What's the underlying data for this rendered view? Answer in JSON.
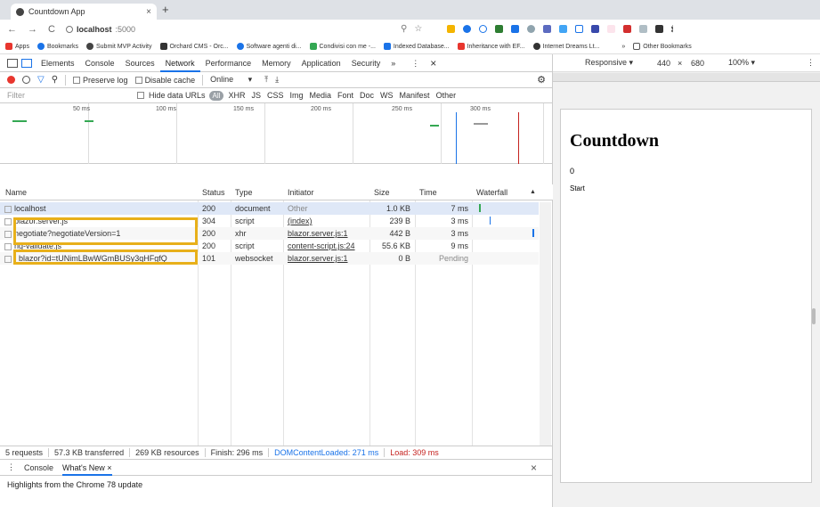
{
  "browser": {
    "tab_title": "Countdown App",
    "tab_close": "×",
    "new_tab": "+",
    "nav_back": "←",
    "nav_forward": "→",
    "nav_reload": "C",
    "url_host": "localhost",
    "url_port": ":5000"
  },
  "bookmarks": [
    {
      "label": "Apps",
      "color": "#e8362e"
    },
    {
      "label": "Bookmarks",
      "color": "#1a73e8"
    },
    {
      "label": "Submit MVP Activity",
      "color": "#444444"
    },
    {
      "label": "Orchard CMS - Orc...",
      "color": "#333333"
    },
    {
      "label": "Software agenti di...",
      "color": "#1a73e8"
    },
    {
      "label": "Condivisi con me -...",
      "color": "#34a853"
    },
    {
      "label": "Indexed Database...",
      "color": "#1a73e8"
    },
    {
      "label": "Inheritance with EF...",
      "color": "#e8362e"
    },
    {
      "label": "Internet Dreams Lt...",
      "color": "#333333"
    }
  ],
  "bookmarks_more": "»",
  "bookmarks_other": "Other Bookmarks",
  "devtools": {
    "tabs": [
      "Elements",
      "Console",
      "Sources",
      "Network",
      "Performance",
      "Memory",
      "Application",
      "Security",
      "»"
    ],
    "active_tab": "Network",
    "close": "×",
    "toolbar": {
      "preserve_log": "Preserve log",
      "disable_cache": "Disable cache",
      "online": "Online",
      "online_arrow": "▾"
    },
    "filter": {
      "placeholder": "Filter",
      "hide_data_urls": "Hide data URLs",
      "all": "All",
      "types": [
        "XHR",
        "JS",
        "CSS",
        "Img",
        "Media",
        "Font",
        "Doc",
        "WS",
        "Manifest",
        "Other"
      ]
    },
    "timeline_ticks": [
      "50 ms",
      "100 ms",
      "150 ms",
      "200 ms",
      "250 ms",
      "300 ms"
    ],
    "columns": [
      "Name",
      "Status",
      "Type",
      "Initiator",
      "Size",
      "Time",
      "Waterfall"
    ],
    "sort_indicator": "▲",
    "requests": [
      {
        "name": "localhost",
        "status": "200",
        "type": "document",
        "initiator": "Other",
        "size": "1.0 KB",
        "time": "7 ms"
      },
      {
        "name": "blazor.server.js",
        "status": "304",
        "type": "script",
        "initiator": "(index)",
        "size": "239 B",
        "time": "3 ms"
      },
      {
        "name": "negotiate?negotiateVersion=1",
        "status": "200",
        "type": "xhr",
        "initiator": "blazor.server.js:1",
        "size": "442 B",
        "time": "3 ms"
      },
      {
        "name": "ng-validate.js",
        "status": "200",
        "type": "script",
        "initiator": "content-script.js:24",
        "size": "55.6 KB",
        "time": "9 ms"
      },
      {
        "name": "_blazor?id=tUNimLBwWGmBUSy3qHFgfQ",
        "status": "101",
        "type": "websocket",
        "initiator": "blazor.server.js:1",
        "size": "0 B",
        "time": "Pending"
      }
    ],
    "summary": {
      "requests": "5 requests",
      "transferred": "57.3 KB transferred",
      "resources": "269 KB resources",
      "finish": "Finish: 296 ms",
      "dom_loaded": "DOMContentLoaded: 271 ms",
      "load": "Load: 309 ms"
    },
    "drawer": {
      "menu": "⋮",
      "console": "Console",
      "whats_new": "What's New",
      "whats_new_close": "×",
      "close": "×",
      "content": "Highlights from the Chrome 78 update"
    }
  },
  "device": {
    "mode": "Responsive",
    "mode_arrow": "▾",
    "width": "440",
    "times": "×",
    "height": "680",
    "zoom": "100%",
    "zoom_arrow": "▾",
    "more": "⋮"
  },
  "app": {
    "heading": "Countdown",
    "counter": "0",
    "start_button": "Start"
  },
  "colors": {
    "highlight": "#e8b01a",
    "accent": "#1a73e8",
    "record": "#e8362e"
  }
}
